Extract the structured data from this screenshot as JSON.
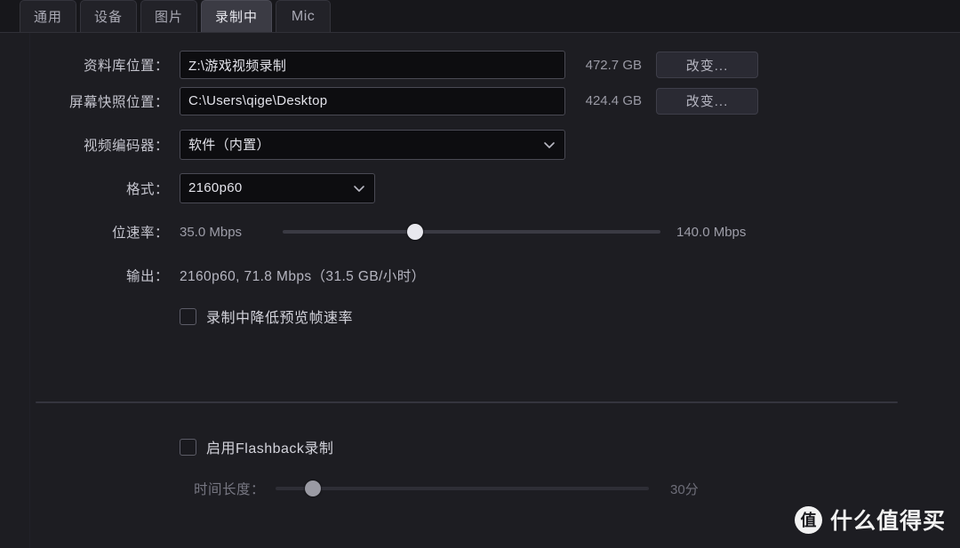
{
  "tabs": [
    {
      "label": "通用",
      "active": false
    },
    {
      "label": "设备",
      "active": false
    },
    {
      "label": "图片",
      "active": false
    },
    {
      "label": "录制中",
      "active": true
    },
    {
      "label": "Mic",
      "active": false
    }
  ],
  "settings": {
    "library": {
      "label": "资料库位置：",
      "value": "Z:\\游戏视频录制",
      "free_space": "472.7 GB",
      "change_label": "改变..."
    },
    "screenshot": {
      "label": "屏幕快照位置：",
      "value": "C:\\Users\\qige\\Desktop",
      "free_space": "424.4 GB",
      "change_label": "改变..."
    },
    "encoder": {
      "label": "视频编码器：",
      "value": "软件（内置）"
    },
    "format": {
      "label": "格式：",
      "value": "2160p60"
    },
    "bitrate": {
      "label": "位速率：",
      "min_label": "35.0 Mbps",
      "max_label": "140.0 Mbps",
      "percent": 35
    },
    "output": {
      "label": "输出：",
      "value": "2160p60, 71.8 Mbps（31.5 GB/小时）"
    },
    "lower_preview": {
      "label": "录制中降低预览帧速率",
      "checked": false
    }
  },
  "flashback": {
    "enable": {
      "label": "启用Flashback录制",
      "checked": false
    },
    "duration": {
      "label": "时间长度：",
      "value_label": "30分",
      "percent": 10
    }
  },
  "watermark": {
    "badge": "值",
    "text": "什么值得买"
  },
  "icons": {
    "chevron_down": "chevron-down-icon"
  }
}
